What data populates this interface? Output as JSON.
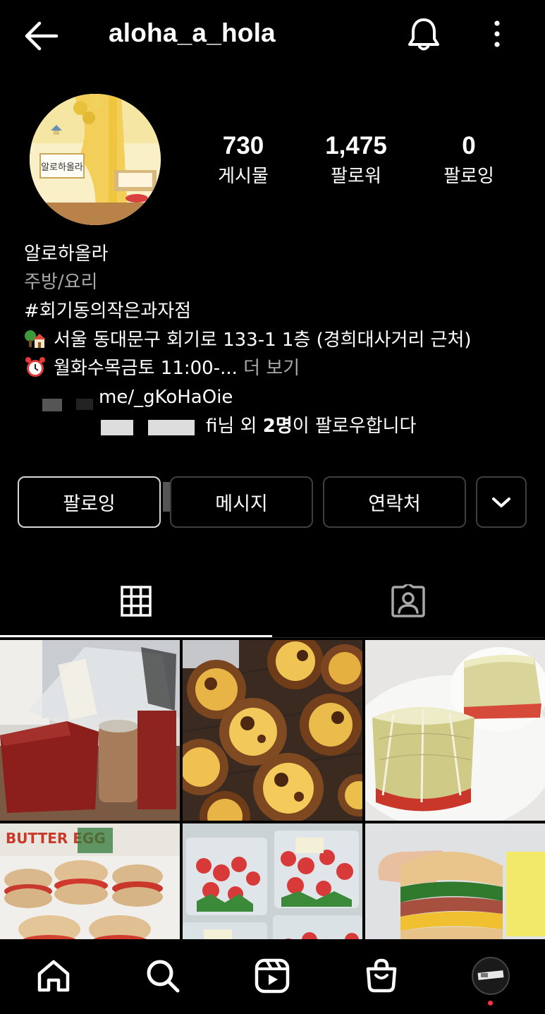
{
  "header": {
    "username": "aloha_a_hola",
    "back_icon": "arrow-left-icon",
    "notification_icon": "bell-icon",
    "menu_icon": "more-vertical-icon"
  },
  "profile": {
    "avatar_text": "알로하올라",
    "stats": [
      {
        "value": "730",
        "label": "게시물"
      },
      {
        "value": "1,475",
        "label": "팔로워"
      },
      {
        "value": "0",
        "label": "팔로잉"
      }
    ],
    "name": "알로하올라",
    "category": "주방/요리",
    "hashtag": "#회기동의작은과자점",
    "address_icon": "house-with-garden-emoji",
    "address": "서울 동대문구 회기로 133-1 1층 (경희대사거리 근처)",
    "hours_icon": "alarm-clock-emoji",
    "hours": "월화수목금토 11:00-...",
    "more_label": "더 보기",
    "link": "me/_gKoHaOie",
    "followed_by_prefix": "fi님 외 ",
    "followed_by_count": "2명",
    "followed_by_suffix": "이 팔로우합니다"
  },
  "actions": {
    "follow_label": "팔로잉",
    "message_label": "메시지",
    "contact_label": "연락처",
    "suggest_icon": "chevron-down-icon"
  },
  "tabs": {
    "grid_icon": "grid-icon",
    "tagged_icon": "tagged-person-icon",
    "active": "grid"
  },
  "grid": {
    "posts": [
      {
        "description": "paper-bag-and-drink-photo"
      },
      {
        "description": "egg-tarts-photo"
      },
      {
        "description": "cheesecake-slices-photo"
      },
      {
        "description": "strawberry-scones-photo"
      },
      {
        "description": "strawberry-packs-photo"
      },
      {
        "description": "sandwich-photo"
      }
    ],
    "overlay_text": "BUTTER EGG"
  },
  "bottom_nav": {
    "items": [
      "home-icon",
      "search-icon",
      "reels-icon",
      "shop-icon",
      "profile-avatar"
    ]
  },
  "colors": {
    "background": "#000000",
    "text": "#ffffff",
    "secondary_text": "#a8a8a8",
    "button_border": "#3e3e3e",
    "notification_dot": "#ff3040"
  }
}
